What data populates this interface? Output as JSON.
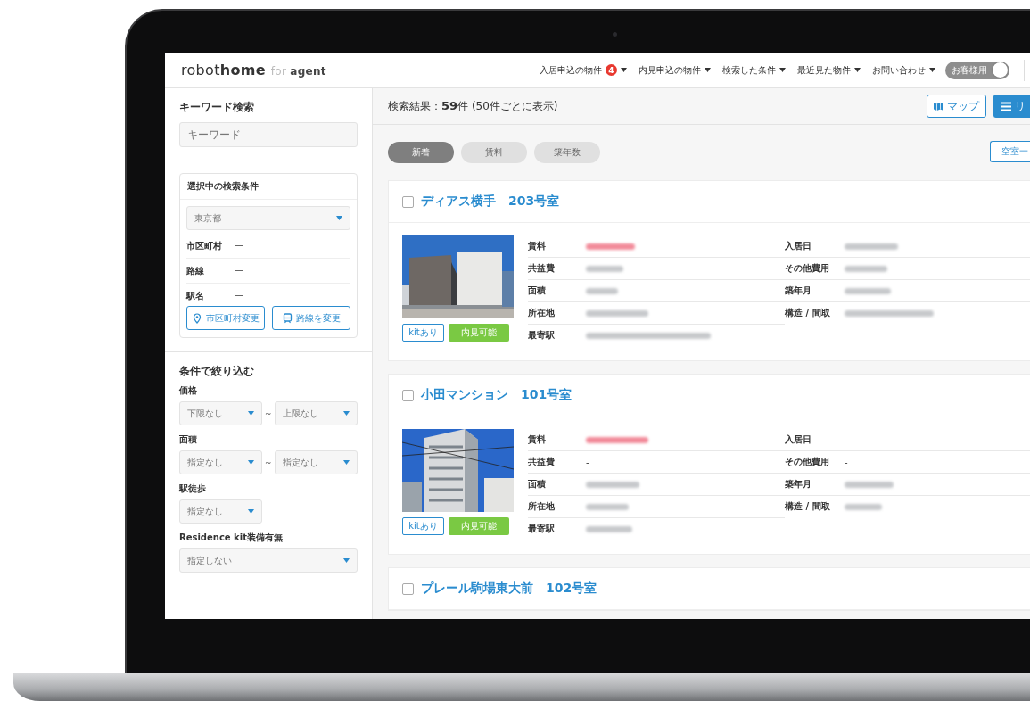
{
  "header": {
    "logo": [
      {
        "text": "robot",
        "kind": "light"
      },
      {
        "text": "home",
        "kind": "bold"
      },
      {
        "text": "for",
        "kind": "faint"
      },
      {
        "text": "agent",
        "kind": "small"
      }
    ],
    "nav": [
      {
        "label": "入居申込の物件",
        "badge": "4"
      },
      {
        "label": "内見申込の物件"
      },
      {
        "label": "検索した条件"
      },
      {
        "label": "最近見た物件"
      },
      {
        "label": "お問い合わせ"
      }
    ],
    "toggle": {
      "label": "お客様用",
      "on": false
    }
  },
  "sidebar": {
    "keyword": {
      "title": "キーワード検索",
      "placeholder": "キーワード"
    },
    "conditions": {
      "title": "選択中の検索条件",
      "prefecture": "東京都",
      "rows": [
        {
          "label": "市区町村",
          "value": "—"
        },
        {
          "label": "路線",
          "value": "—"
        },
        {
          "label": "駅名",
          "value": "—"
        }
      ],
      "buttons": [
        {
          "label": "市区町村変更",
          "kind": "pin"
        },
        {
          "label": "路線を変更",
          "kind": "train"
        }
      ]
    },
    "filters": {
      "title": "条件で絞り込む",
      "groups": [
        {
          "label": "価格",
          "kind": "range",
          "selects": [
            "下限なし",
            "上限なし"
          ],
          "separator": "~"
        },
        {
          "label": "面積",
          "kind": "range",
          "selects": [
            "指定なし",
            "指定なし"
          ],
          "separator": "~"
        },
        {
          "label": "駅徒歩",
          "kind": "single",
          "selects": [
            "指定なし"
          ]
        },
        {
          "label": "Residence kit装備有無",
          "kind": "full",
          "selects": [
            "指定しない"
          ]
        }
      ]
    }
  },
  "results": {
    "summary": "検索結果：**59**件 (50件ごとに表示)",
    "view_buttons": [
      {
        "label": "マップ",
        "kind": "map",
        "selected": false
      },
      {
        "label": "リ",
        "kind": "list",
        "selected": true
      }
    ],
    "sort_tabs": [
      {
        "label": "新着",
        "selected": true
      },
      {
        "label": "賃料",
        "selected": false
      },
      {
        "label": "築年数",
        "selected": false
      }
    ],
    "vacancy_button": "空室一"
  },
  "listings": [
    {
      "title": "ディアス横手　203号室",
      "checked": false,
      "tags": [
        {
          "label": "kitあり",
          "kind": "outline"
        },
        {
          "label": "内見可能",
          "kind": "solid"
        }
      ],
      "left": [
        {
          "label": "賃料",
          "redacted": true,
          "alert": true
        },
        {
          "label": "共益費",
          "redacted": true,
          "alert": false
        },
        {
          "label": "面積",
          "redacted": true,
          "alert": false
        },
        {
          "label": "所在地",
          "redacted": true,
          "alert": false
        },
        {
          "label": "最寄駅",
          "redacted": true,
          "alert": false
        }
      ],
      "right": [
        {
          "label": "入居日",
          "redacted": true,
          "alert": false
        },
        {
          "label": "その他費用",
          "redacted": true,
          "alert": false
        },
        {
          "label": "築年月",
          "redacted": true,
          "alert": false
        },
        {
          "label": "構造 / 間取",
          "redacted": true,
          "alert": false
        }
      ]
    },
    {
      "title": "小田マンション　101号室",
      "checked": false,
      "tags": [
        {
          "label": "kitあり",
          "kind": "outline"
        },
        {
          "label": "内見可能",
          "kind": "solid"
        }
      ],
      "left": [
        {
          "label": "賃料",
          "redacted": true,
          "alert": true
        },
        {
          "label": "共益費",
          "redacted": false,
          "value": "-"
        },
        {
          "label": "面積",
          "redacted": true,
          "alert": false
        },
        {
          "label": "所在地",
          "redacted": true,
          "alert": false
        },
        {
          "label": "最寄駅",
          "redacted": true,
          "alert": false
        }
      ],
      "right": [
        {
          "label": "入居日",
          "redacted": false,
          "value": "-"
        },
        {
          "label": "その他費用",
          "redacted": false,
          "value": "-"
        },
        {
          "label": "築年月",
          "redacted": true,
          "alert": false
        },
        {
          "label": "構造 / 間取",
          "redacted": true,
          "alert": false
        }
      ]
    },
    {
      "title": "プレール駒場東大前　102号室",
      "checked": false
    }
  ]
}
